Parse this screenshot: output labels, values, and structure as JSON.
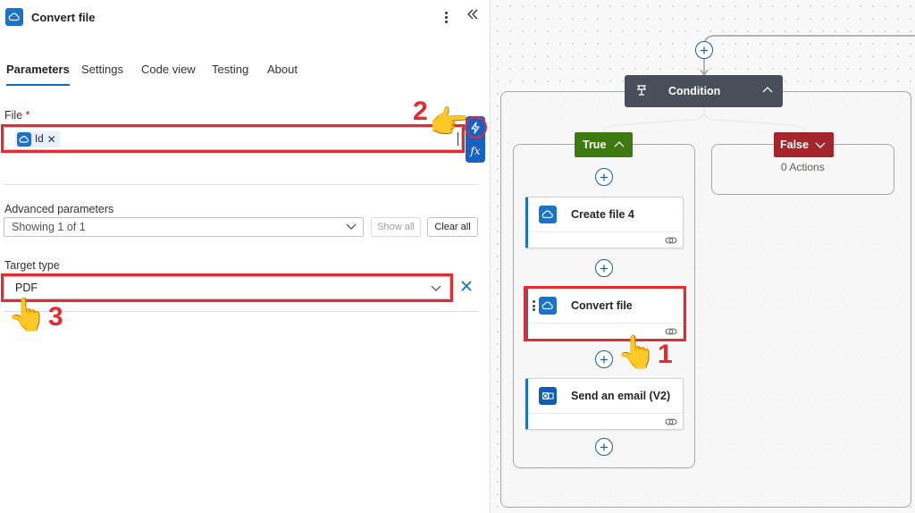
{
  "panel": {
    "title": "Convert file",
    "tabs": [
      {
        "label": "Parameters",
        "active": true
      },
      {
        "label": "Settings",
        "active": false
      },
      {
        "label": "Code view",
        "active": false
      },
      {
        "label": "Testing",
        "active": false
      },
      {
        "label": "About",
        "active": false
      }
    ],
    "file": {
      "label": "File",
      "required_marker": "*",
      "token_label": "Id",
      "token_remove": "✕",
      "fx_label": "fx"
    },
    "advanced": {
      "label": "Advanced parameters",
      "select_value": "Showing 1 of 1",
      "show_all": "Show all",
      "clear_all": "Clear all"
    },
    "target_type": {
      "label": "Target type",
      "value": "PDF"
    }
  },
  "annotations": {
    "step1": "1",
    "step2": "2",
    "step3": "3",
    "hand": "👆"
  },
  "canvas": {
    "condition_label": "Condition",
    "true_label": "True",
    "false_label": "False",
    "false_actions": "0 Actions",
    "actions": [
      {
        "title": "Create file 4",
        "icon": "onedrive-icon"
      },
      {
        "title": "Convert file",
        "icon": "onedrive-icon"
      },
      {
        "title": "Send an email (V2)",
        "icon": "outlook-icon"
      }
    ]
  },
  "colors": {
    "accent": "#0f6cbd",
    "onedrive": "#1a73c9",
    "condition": "#484f5b",
    "true_branch": "#3d7b11",
    "false_branch": "#a4262c",
    "highlight": "#e52a30"
  }
}
